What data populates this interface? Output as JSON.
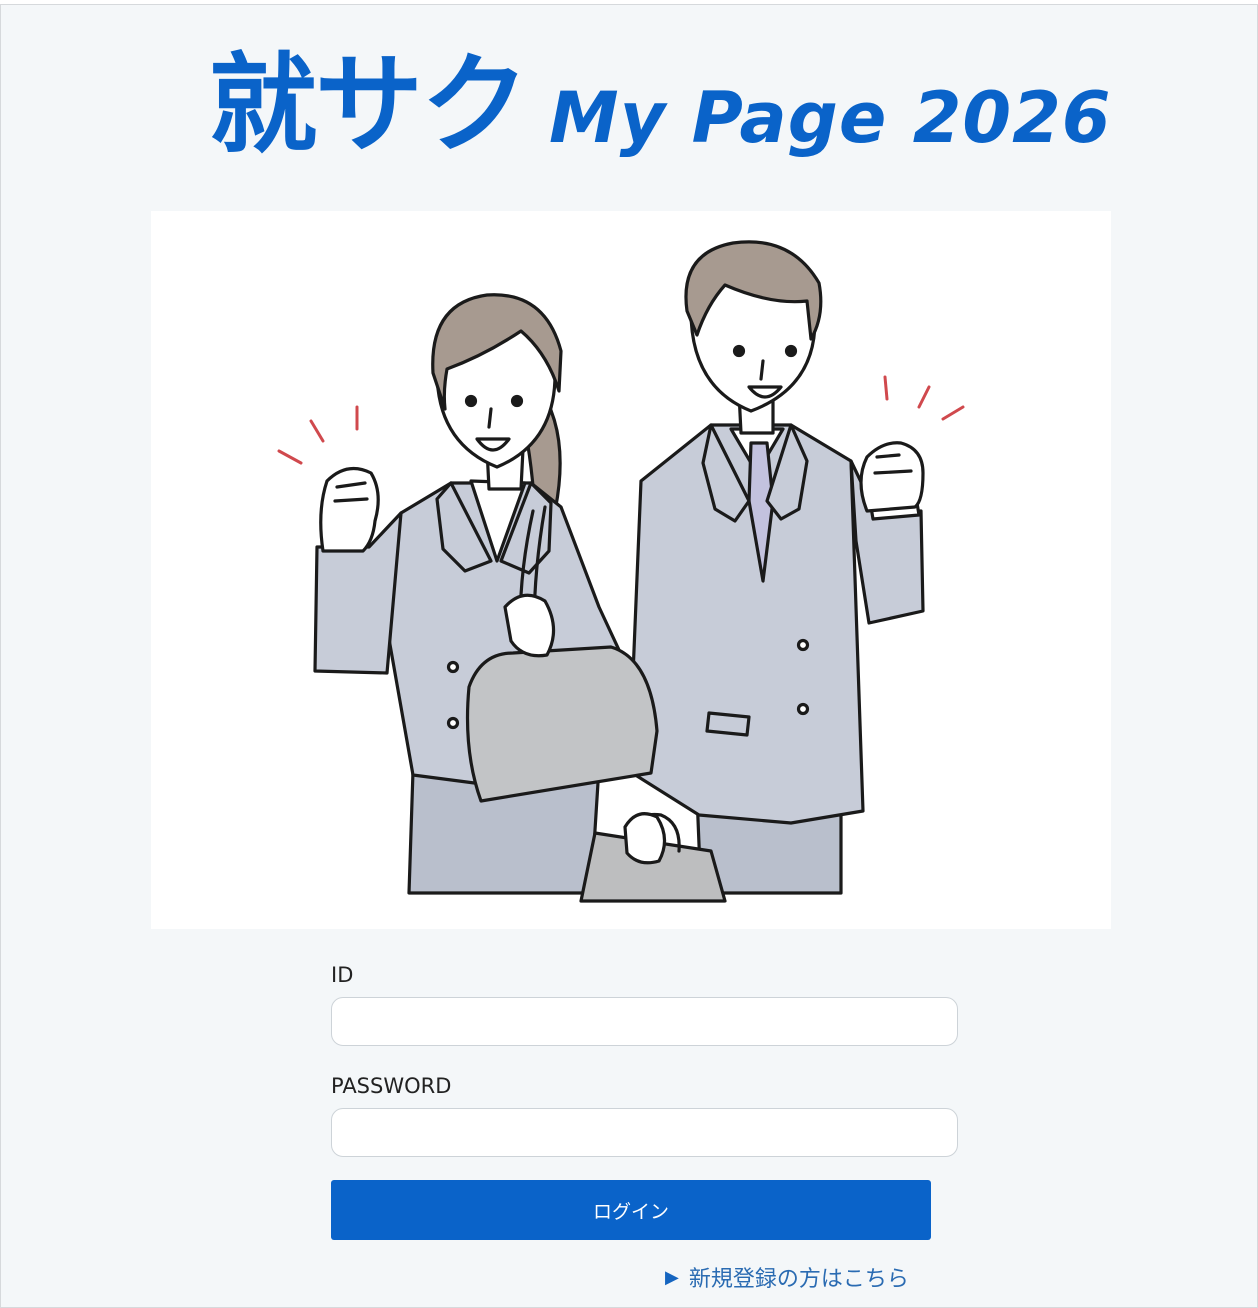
{
  "header": {
    "title_jp": "就サク",
    "title_en": "My Page 2026"
  },
  "hero": {
    "image_icon": "business-people-cheering-illustration"
  },
  "login_form": {
    "id_label": "ID",
    "id_value": "",
    "password_label": "PASSWORD",
    "password_value": "",
    "login_button": "ログイン"
  },
  "register_link": {
    "arrow": "▶",
    "label": "新規登録の方はこちら"
  },
  "colors": {
    "brand_blue": "#0a63c9",
    "link_blue": "#2a6bb2",
    "background": "#f4f7f9"
  }
}
